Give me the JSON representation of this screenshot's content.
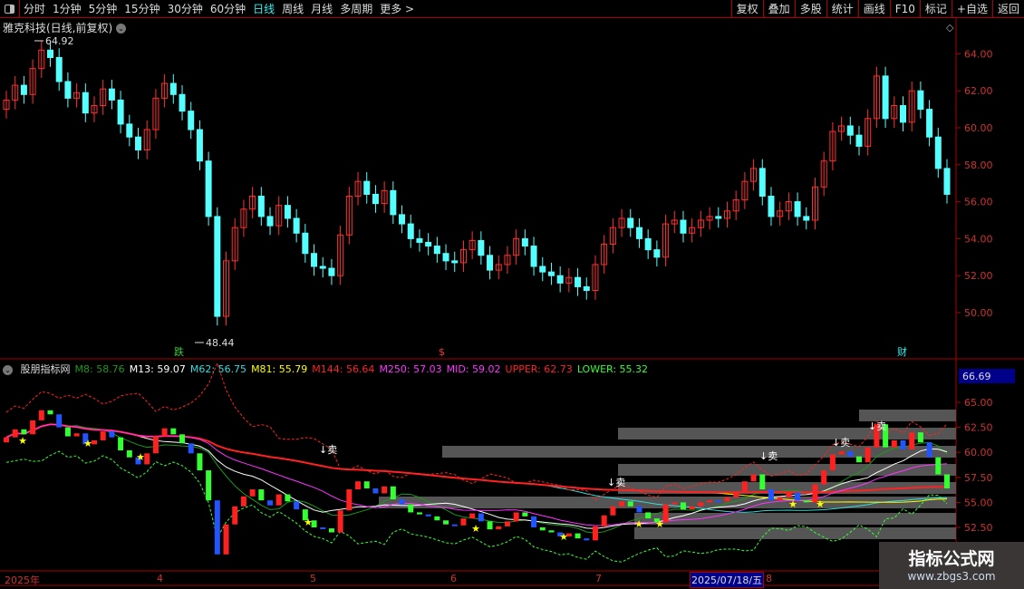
{
  "toolbar": {
    "periods": [
      "分时",
      "1分钟",
      "5分钟",
      "15分钟",
      "30分钟",
      "60分钟",
      "日线",
      "周线",
      "月线",
      "多周期",
      "更多 >"
    ],
    "active": "日线",
    "buttons": [
      "复权",
      "叠加",
      "多股",
      "统计",
      "画线",
      "F10",
      "标记",
      "+自选",
      "返回"
    ]
  },
  "main_chart": {
    "title": "雅克科技(日线,前复权)",
    "high_label": "64.92",
    "low_label": "48.44",
    "price_ticks": [
      "64.00",
      "62.00",
      "60.00",
      "58.00",
      "56.00",
      "54.00",
      "52.00",
      "50.00"
    ],
    "markers": [
      "跌",
      "$",
      "财"
    ],
    "closes": [
      61.5,
      62.3,
      61.8,
      63.2,
      64.2,
      63.8,
      62.5,
      61.6,
      61.9,
      60.8,
      61.2,
      62.1,
      61.5,
      60.2,
      59.5,
      58.8,
      59.9,
      61.6,
      62.4,
      61.8,
      60.9,
      59.9,
      58.2,
      55.2,
      49.8,
      52.8,
      54.6,
      55.6,
      56.3,
      55.2,
      54.7,
      55.8,
      55.1,
      54.3,
      53.2,
      52.5,
      52.4,
      52.0,
      54.2,
      56.3,
      57.1,
      56.4,
      55.9,
      56.6,
      55.3,
      54.8,
      54.0,
      53.8,
      53.6,
      53.2,
      52.8,
      52.7,
      53.4,
      53.9,
      53.1,
      52.3,
      52.6,
      53.1,
      54.0,
      53.6,
      52.5,
      52.2,
      52.0,
      51.6,
      51.9,
      51.4,
      51.2,
      52.6,
      53.7,
      54.6,
      55.1,
      54.6,
      54.0,
      53.4,
      53.0,
      54.8,
      55.0,
      54.3,
      54.6,
      55.0,
      55.2,
      55.1,
      55.5,
      56.1,
      57.1,
      57.8,
      56.3,
      55.2,
      55.5,
      56.0,
      55.2,
      55.0,
      56.8,
      58.2,
      59.8,
      60.1,
      59.6,
      59.0,
      60.5,
      62.8,
      60.5,
      61.2,
      60.3,
      62.0,
      61.0,
      59.5,
      57.8,
      56.4
    ]
  },
  "indicator": {
    "name": "股朋指标网",
    "values": [
      {
        "label": "M8",
        "value": "58.76",
        "color": "#1a9a1a"
      },
      {
        "label": "M13",
        "value": "59.07",
        "color": "#ffffff"
      },
      {
        "label": "M62",
        "value": "56.75",
        "color": "#33dddd"
      },
      {
        "label": "M81",
        "value": "55.79",
        "color": "#ffff00"
      },
      {
        "label": "M144",
        "value": "56.64",
        "color": "#ff2222"
      },
      {
        "label": "M250",
        "value": "57.03",
        "color": "#ff33ff"
      },
      {
        "label": "MID",
        "value": "59.02",
        "color": "#ff33ff"
      },
      {
        "label": "UPPER",
        "value": "62.73",
        "color": "#ff2222"
      },
      {
        "label": "LOWER",
        "value": "55.32",
        "color": "#33ff33"
      }
    ],
    "ticks": [
      "65.00",
      "62.50",
      "60.00",
      "57.50",
      "55.00",
      "52.50"
    ],
    "current": "66.69",
    "sell_label": "↓卖"
  },
  "time_axis": {
    "labels": [
      "2025年",
      "4",
      "5",
      "6",
      "7",
      "8"
    ],
    "cursor_date": "2025/07/18/五"
  },
  "watermark": {
    "title": "指标公式网",
    "url": "www.zbgs3.com"
  },
  "colors": {
    "up": "#ff3030",
    "down": "#54ffff",
    "frame": "#aa0000"
  }
}
